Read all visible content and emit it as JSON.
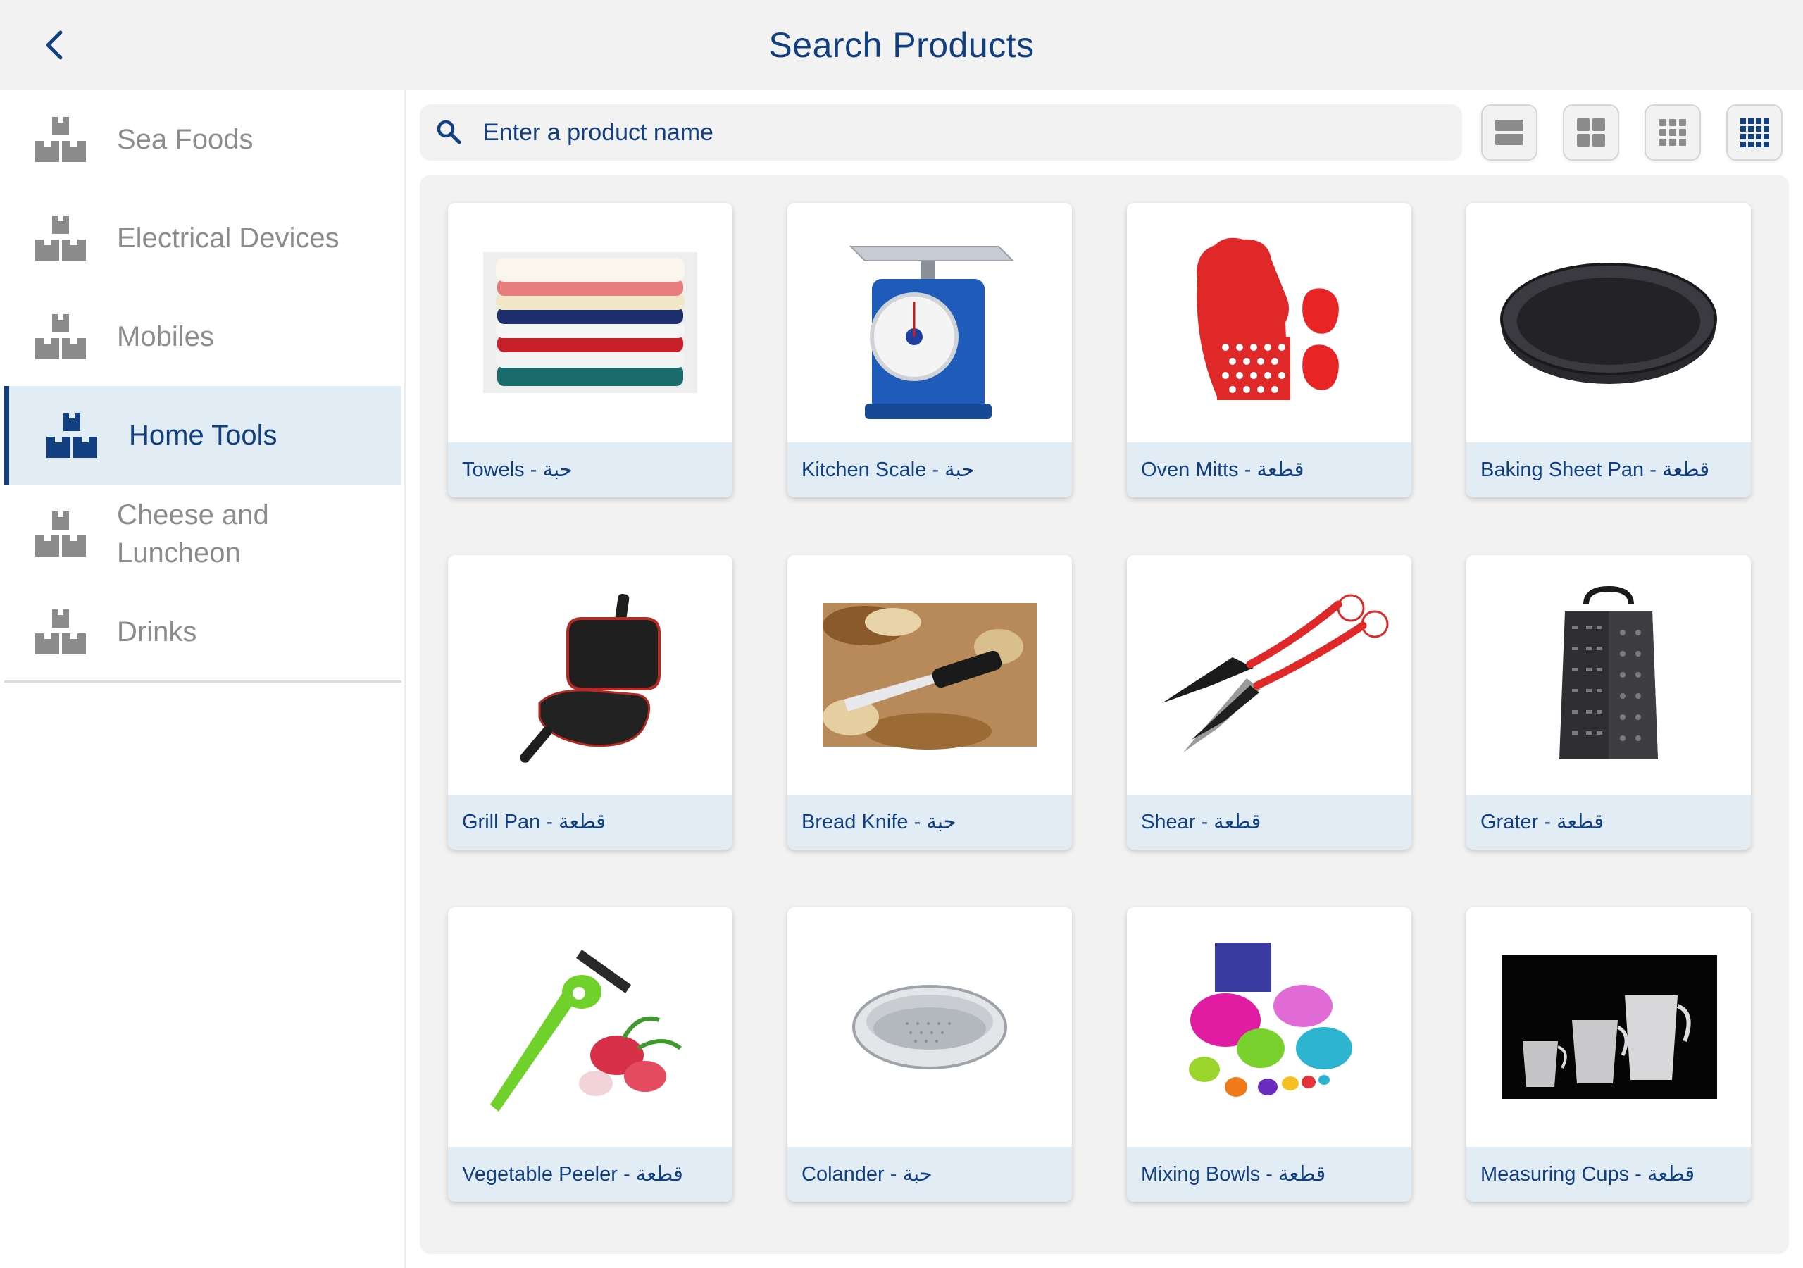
{
  "header": {
    "title": "Search Products",
    "back_icon": "chevron-left-icon"
  },
  "colors": {
    "brand": "#123f7f",
    "header_bg": "#f2f2f2",
    "active_bg": "#e1ecf5",
    "muted_text": "#8c8c8c"
  },
  "sidebar": {
    "categories": [
      {
        "label": "Sea Foods",
        "icon": "boxes-icon",
        "active": false
      },
      {
        "label": "Electrical Devices",
        "icon": "boxes-icon",
        "active": false
      },
      {
        "label": "Mobiles",
        "icon": "boxes-icon",
        "active": false
      },
      {
        "label": "Home Tools",
        "icon": "boxes-icon",
        "active": true
      },
      {
        "label": "Cheese and Luncheon",
        "icon": "boxes-icon",
        "active": false
      },
      {
        "label": "Drinks",
        "icon": "boxes-icon",
        "active": false
      }
    ]
  },
  "search": {
    "placeholder": "Enter a product name",
    "value": "",
    "icon": "search-icon"
  },
  "layout_options": [
    {
      "name": "1-column-layout",
      "icon": "rows-icon",
      "selected": false
    },
    {
      "name": "2-column-layout",
      "icon": "grid-2-icon",
      "selected": false
    },
    {
      "name": "3-column-layout",
      "icon": "grid-3-icon",
      "selected": false
    },
    {
      "name": "4-column-layout",
      "icon": "grid-4-icon",
      "selected": true
    }
  ],
  "products": [
    {
      "caption": "Towels - حبة",
      "image": "towels-image"
    },
    {
      "caption": "Kitchen Scale - حبة",
      "image": "kitchen-scale-image"
    },
    {
      "caption": "Oven Mitts - قطعة",
      "image": "oven-mitts-image"
    },
    {
      "caption": "Baking Sheet Pan - قطعة",
      "image": "baking-pan-image"
    },
    {
      "caption": "Grill Pan - قطعة",
      "image": "grill-pan-image"
    },
    {
      "caption": "Bread Knife - حبة",
      "image": "bread-knife-image"
    },
    {
      "caption": "Shear - قطعة",
      "image": "shear-image"
    },
    {
      "caption": "Grater - قطعة",
      "image": "grater-image"
    },
    {
      "caption": "Vegetable Peeler - قطعة",
      "image": "peeler-image"
    },
    {
      "caption": "Colander - حبة",
      "image": "colander-image"
    },
    {
      "caption": "Mixing Bowls - قطعة",
      "image": "mixing-bowls-image"
    },
    {
      "caption": "Measuring Cups - قطعة",
      "image": "measuring-cups-image"
    }
  ]
}
